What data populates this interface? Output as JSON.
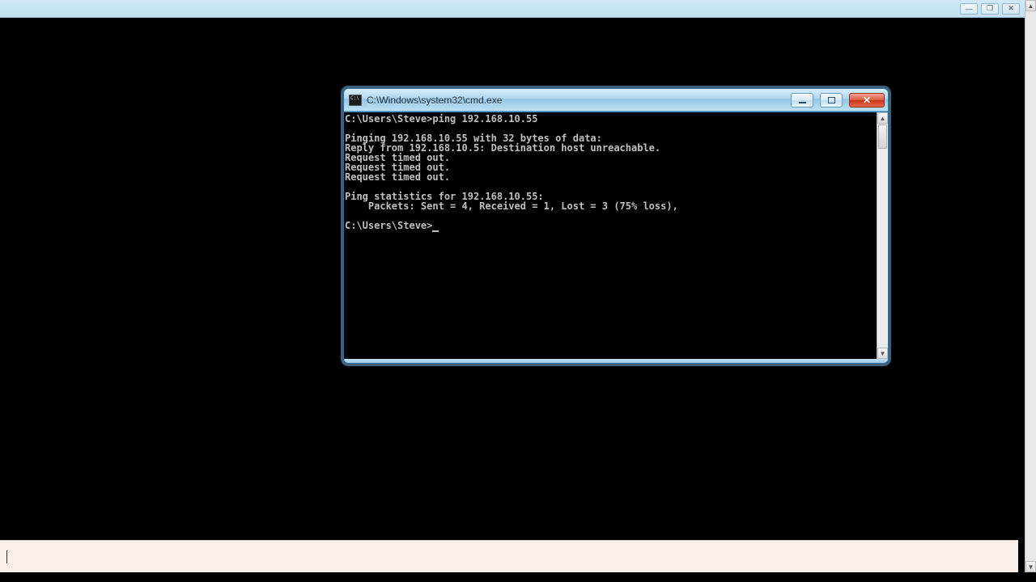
{
  "outer": {
    "minimize_tip": "Minimize",
    "maximize_tip": "Restore",
    "close_tip": "Close"
  },
  "cmd": {
    "title": "C:\\Windows\\system32\\cmd.exe",
    "lines": {
      "l0": "C:\\Users\\Steve>ping 192.168.10.55",
      "l1": "",
      "l2": "Pinging 192.168.10.55 with 32 bytes of data:",
      "l3": "Reply from 192.168.10.5: Destination host unreachable.",
      "l4": "Request timed out.",
      "l5": "Request timed out.",
      "l6": "Request timed out.",
      "l7": "",
      "l8": "Ping statistics for 192.168.10.55:",
      "l9": "    Packets: Sent = 4, Received = 1, Lost = 3 (75% loss),",
      "l10": "",
      "l11_prompt": "C:\\Users\\Steve>"
    }
  }
}
